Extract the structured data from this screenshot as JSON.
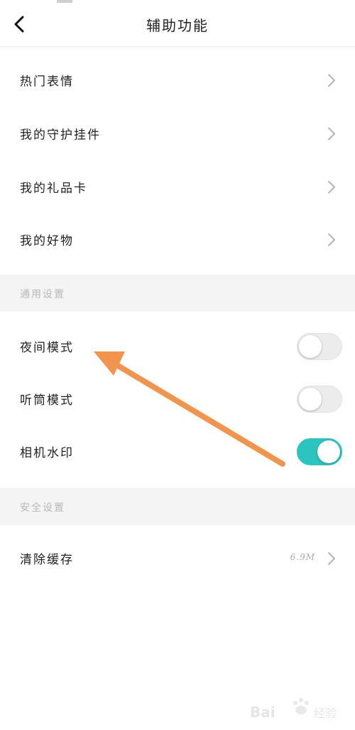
{
  "header": {
    "title": "辅助功能"
  },
  "menu_group_1": [
    {
      "label": "热门表情"
    },
    {
      "label": "我的守护挂件"
    },
    {
      "label": "我的礼品卡"
    },
    {
      "label": "我的好物"
    }
  ],
  "general_settings": {
    "section_label": "通用设置",
    "items": [
      {
        "label": "夜间模式",
        "enabled": false
      },
      {
        "label": "听筒模式",
        "enabled": false
      },
      {
        "label": "相机水印",
        "enabled": true
      }
    ]
  },
  "security_settings": {
    "section_label": "安全设置",
    "items": [
      {
        "label": "清除缓存",
        "value": "6.9M"
      }
    ]
  },
  "colors": {
    "toggle_on": "#2cc4bf",
    "annotation_arrow": "#f0944e"
  },
  "icons": {
    "back": "chevron-left-icon",
    "row_arrow": "chevron-right-icon"
  }
}
